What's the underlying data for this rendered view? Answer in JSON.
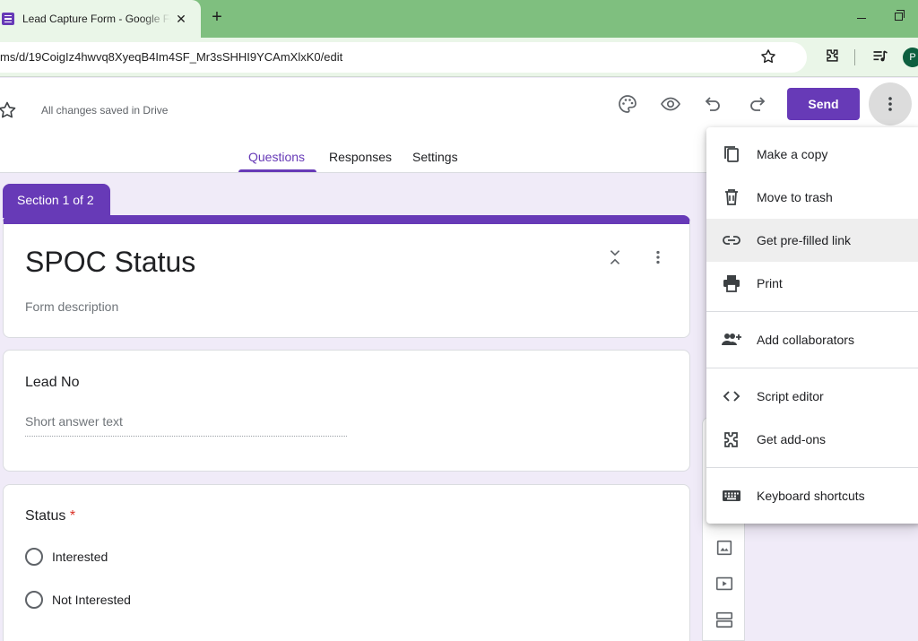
{
  "browser": {
    "tab_title": "Lead Capture Form - Google Forms",
    "tab_close": "✕",
    "new_tab": "+",
    "url": "ms/d/19CoigIz4hwvq8XyeqB4Im4SF_Mr3sSHHI9YCAmXlxK0/edit",
    "profile_initial": "P"
  },
  "header": {
    "save_status": "All changes saved in Drive",
    "send_label": "Send",
    "tabs": [
      {
        "label": "Questions",
        "active": true
      },
      {
        "label": "Responses",
        "active": false
      },
      {
        "label": "Settings",
        "active": false
      }
    ]
  },
  "form": {
    "section_label": "Section 1 of 2",
    "title": "SPOC Status",
    "description_placeholder": "Form description",
    "questions": [
      {
        "title": "Lead No",
        "type": "short_answer",
        "placeholder": "Short answer text",
        "required": false
      },
      {
        "title": "Status",
        "type": "multiple_choice",
        "required": true,
        "required_mark": "*",
        "options": [
          "Interested",
          "Not Interested"
        ]
      }
    ]
  },
  "more_menu": {
    "items": [
      {
        "label": "Make a copy",
        "icon": "copy-icon"
      },
      {
        "label": "Move to trash",
        "icon": "trash-icon"
      },
      {
        "label": "Get pre-filled link",
        "icon": "link-icon",
        "highlighted": true
      },
      {
        "label": "Print",
        "icon": "print-icon"
      },
      {
        "label": "Add collaborators",
        "icon": "add-people-icon"
      },
      {
        "label": "Script editor",
        "icon": "code-icon"
      },
      {
        "label": "Get add-ons",
        "icon": "puzzle-icon"
      },
      {
        "label": "Keyboard shortcuts",
        "icon": "keyboard-icon"
      }
    ]
  },
  "colors": {
    "brand_purple": "#673ab7",
    "page_background": "#f0ebf8",
    "browser_frame": "#7fbf7f",
    "required_red": "#d93025"
  }
}
